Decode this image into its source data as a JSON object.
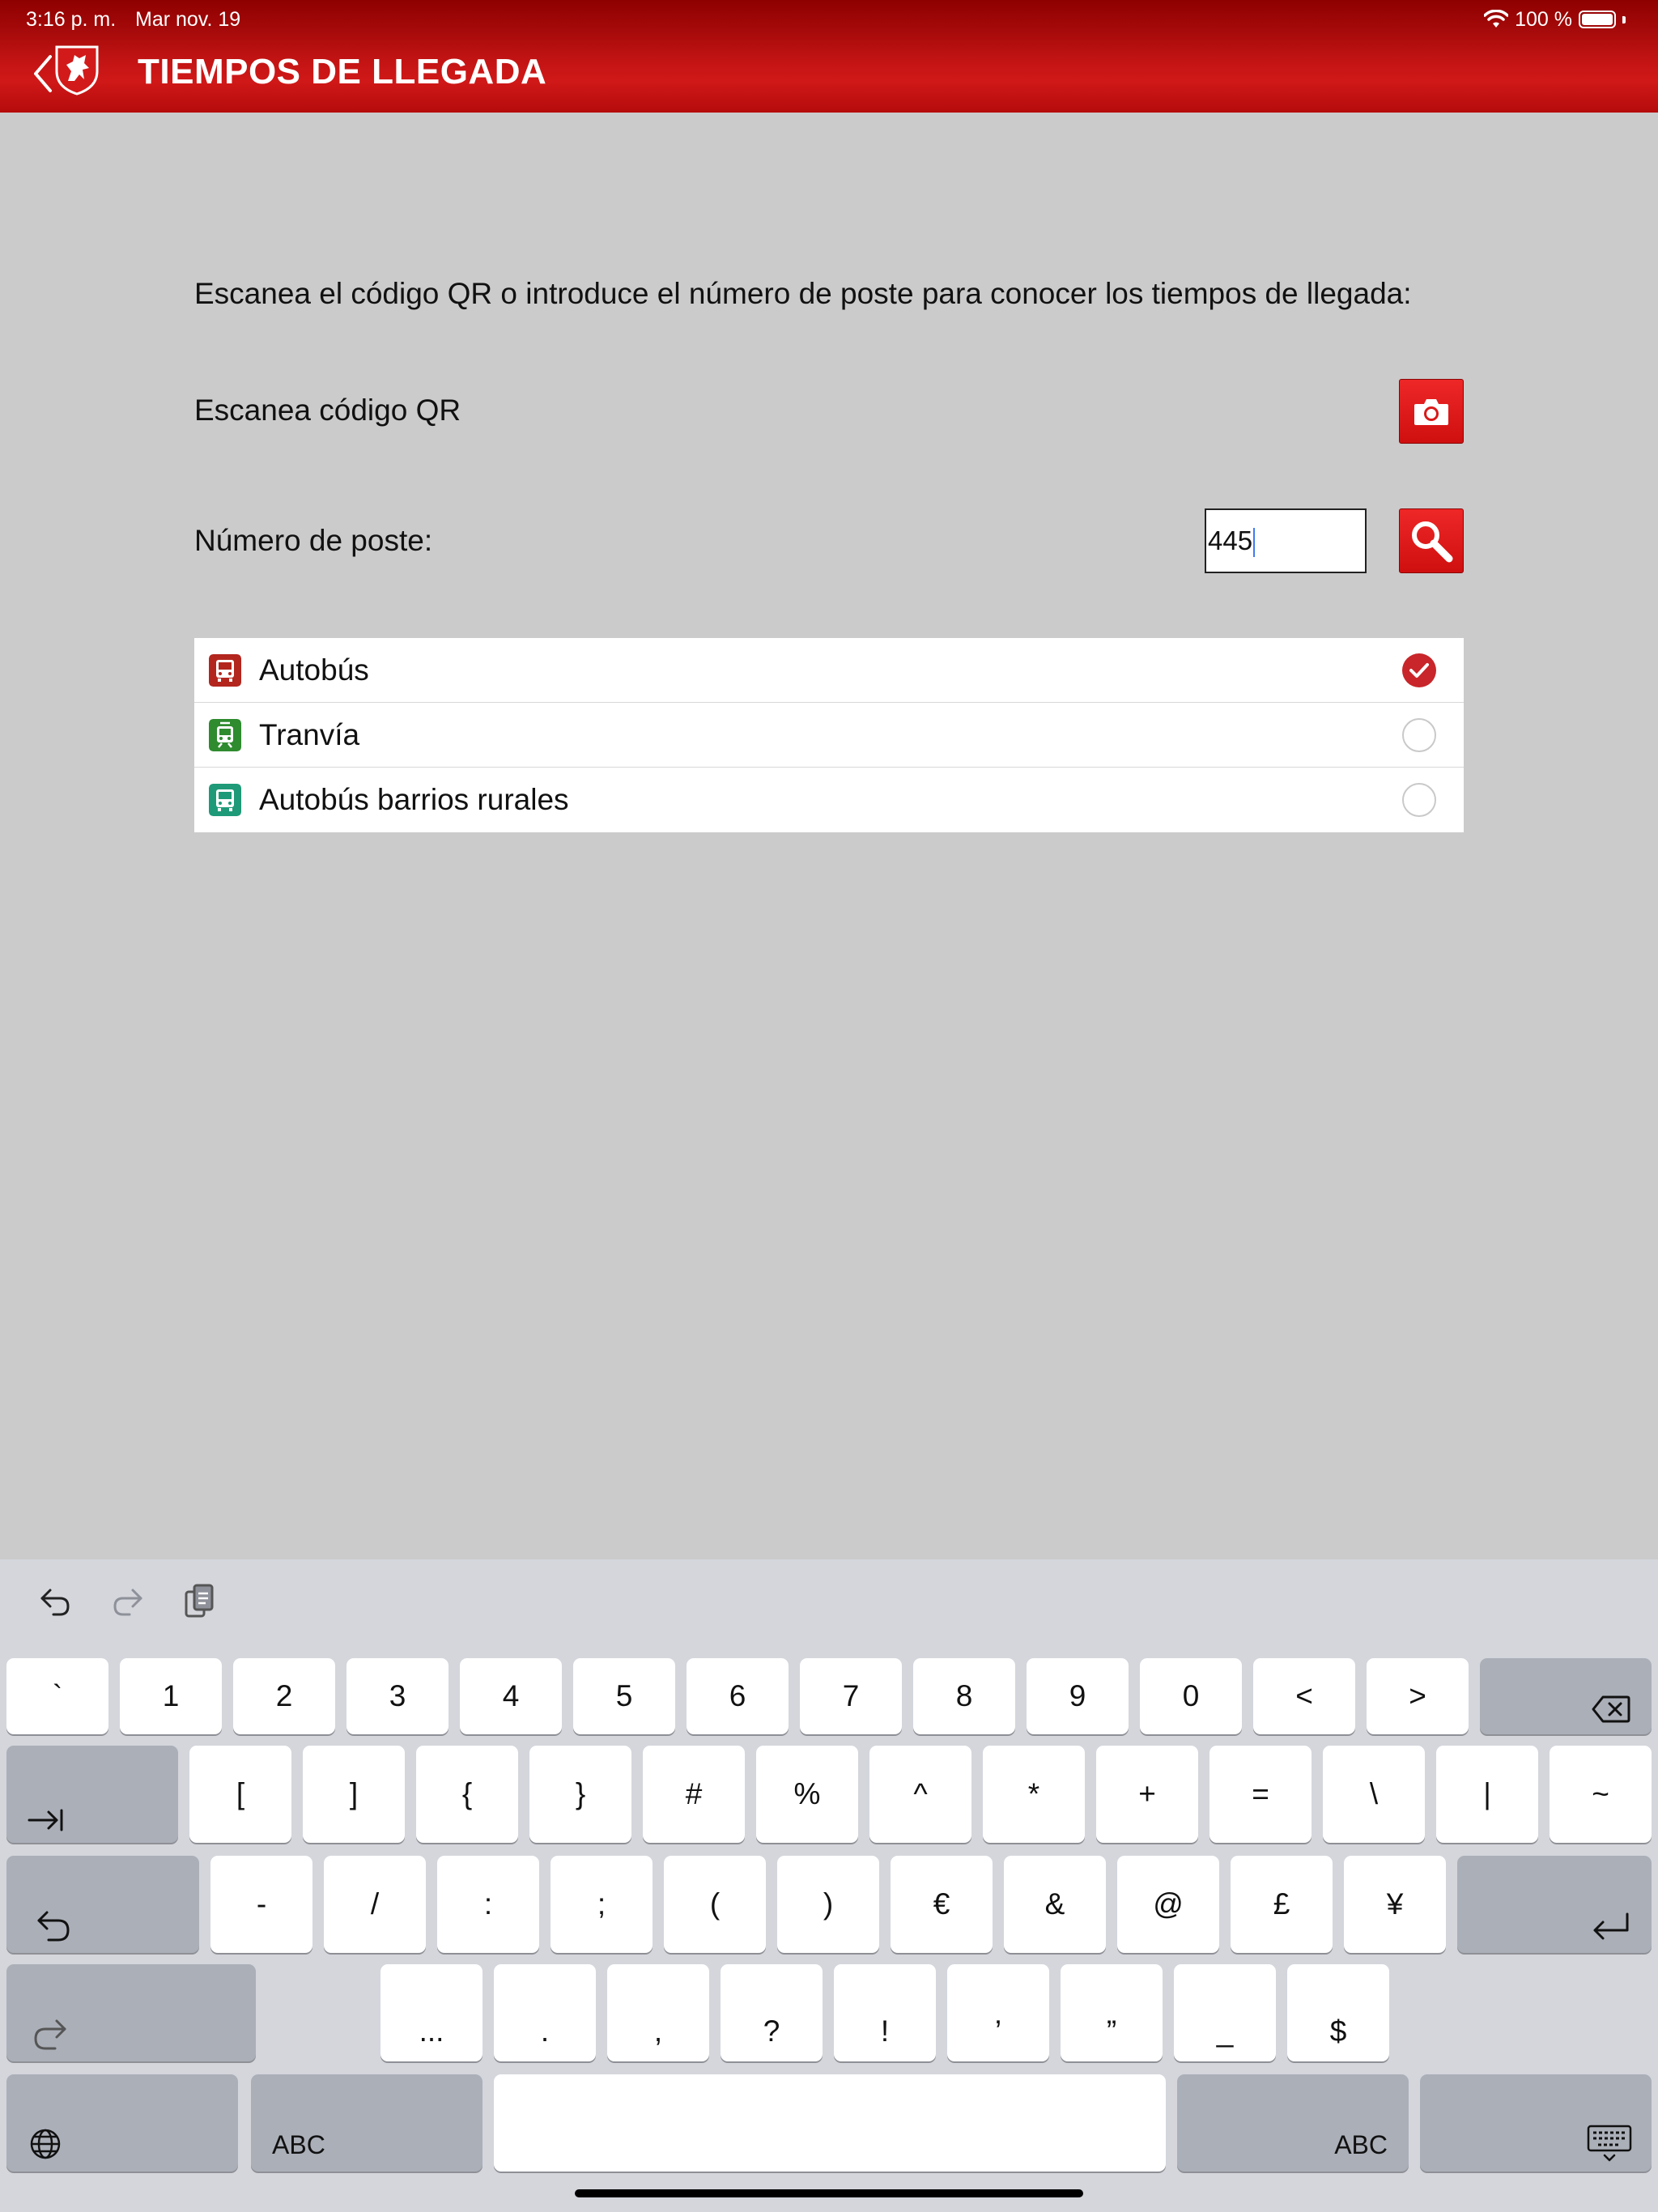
{
  "status_bar": {
    "time": "3:16 p. m.",
    "date": "Mar nov. 19",
    "battery": "100 %"
  },
  "header": {
    "title": "TIEMPOS DE LLEGADA"
  },
  "content": {
    "instructions": "Escanea el código QR o introduce el número de poste para conocer los tiempos de llegada:",
    "qr_label": "Escanea código QR",
    "poste_label": "Número de poste:",
    "poste_value": "445"
  },
  "transport_options": [
    {
      "label": "Autobús",
      "selected": true,
      "color": "#b3261e"
    },
    {
      "label": "Tranvía",
      "selected": false,
      "color": "#2e8b2e"
    },
    {
      "label": "Autobús barrios rurales",
      "selected": false,
      "color": "#1e9a78"
    }
  ],
  "keyboard": {
    "row1": [
      "`",
      "1",
      "2",
      "3",
      "4",
      "5",
      "6",
      "7",
      "8",
      "9",
      "0",
      "<",
      ">"
    ],
    "row2": [
      "[",
      "]",
      "{",
      "}",
      "#",
      "%",
      "^",
      "*",
      "+",
      "=",
      "\\",
      "|",
      "~"
    ],
    "row3": [
      "-",
      "/",
      ":",
      ";",
      "(",
      ")",
      "€",
      "&",
      "@",
      "£",
      "¥"
    ],
    "row4": [
      "...",
      ".",
      ",",
      "?",
      "!",
      "’",
      "”",
      "_",
      "$"
    ],
    "abc_left": "ABC",
    "abc_right": "ABC"
  },
  "colors": {
    "header_red": "#c41414",
    "button_red": "#e01f1f",
    "check_red": "#c8262a",
    "background": "#cbcbcb"
  }
}
